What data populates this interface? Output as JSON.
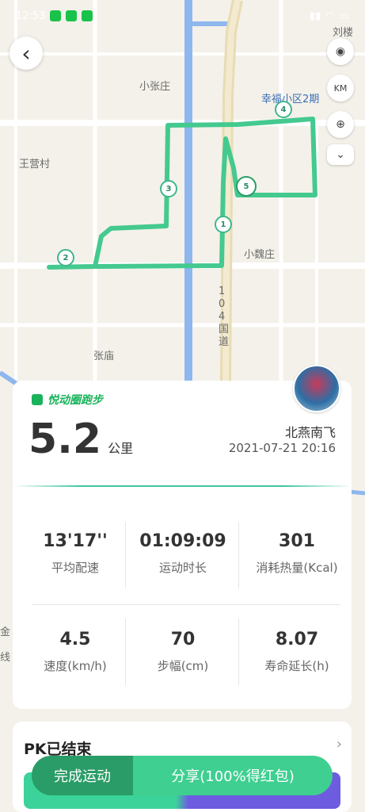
{
  "status": {
    "time": "12:53"
  },
  "map": {
    "places": {
      "liulou": "刘楼",
      "xiaozhangzhuang": "小张庄",
      "xingfu": "幸福小区2期",
      "wangyingcun": "王营村",
      "xiaoweizhuang": "小魏庄",
      "road": "104国道",
      "zhangmiao": "张庙",
      "jin": "金",
      "xian": "线"
    },
    "km_markers": [
      "1",
      "2",
      "3",
      "4",
      "5"
    ],
    "controls": {
      "km": "KM"
    }
  },
  "summary": {
    "brand": "悦动圈跑步",
    "distance_value": "5.2",
    "distance_unit": "公里",
    "user_name": "北燕南飞",
    "datetime": "2021-07-21 20:16"
  },
  "stats": [
    {
      "value": "13'17''",
      "label": "平均配速"
    },
    {
      "value": "01:09:09",
      "label": "运动时长"
    },
    {
      "value": "301",
      "label": "消耗热量(Kcal)"
    },
    {
      "value": "4.5",
      "label": "速度(km/h)"
    },
    {
      "value": "70",
      "label": "步幅(cm)"
    },
    {
      "value": "8.07",
      "label": "寿命延长(h)"
    }
  ],
  "pk": {
    "title": "PK已结束"
  },
  "actions": {
    "finish": "完成运动",
    "share": "分享(100%得红包)"
  },
  "colors": {
    "route": "#44c98f",
    "accent": "#1ab35b"
  }
}
